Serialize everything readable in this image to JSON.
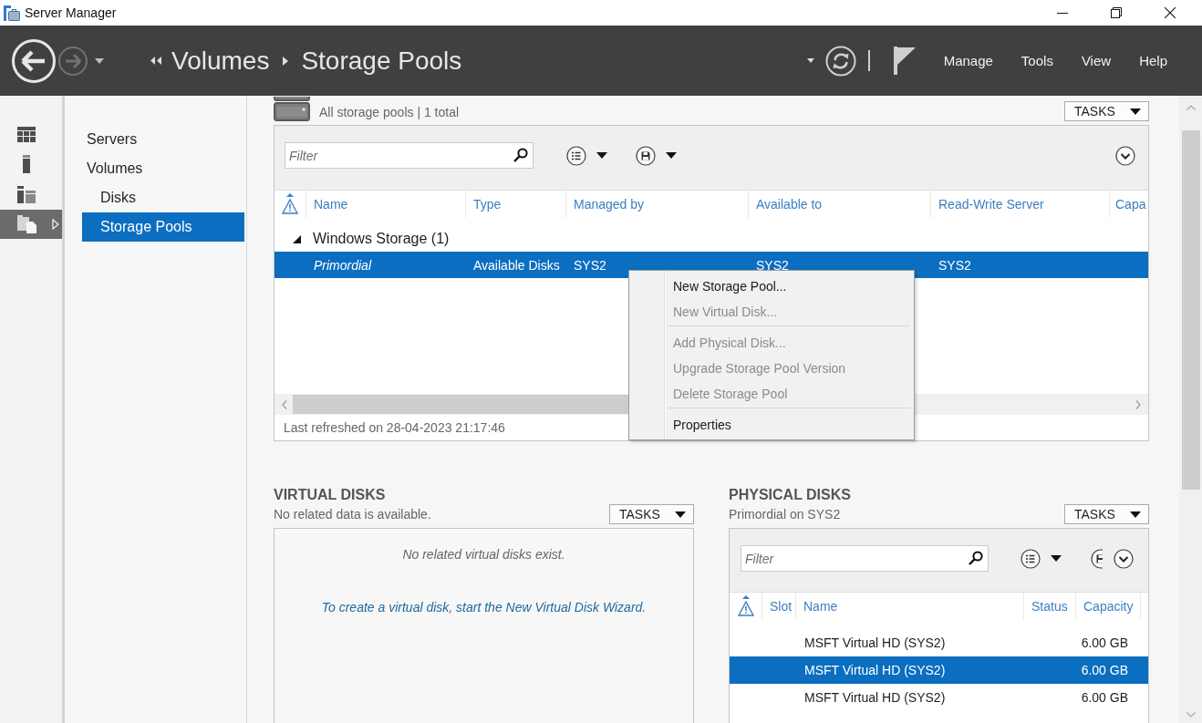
{
  "window": {
    "title": "Server Manager"
  },
  "header": {
    "breadcrumb": [
      "Volumes",
      "Storage Pools"
    ],
    "menu": [
      "Manage",
      "Tools",
      "View",
      "Help"
    ]
  },
  "rail": [
    {
      "selected": false
    },
    {
      "selected": false
    },
    {
      "selected": false
    },
    {
      "selected": true
    }
  ],
  "nav": [
    {
      "label": "Servers",
      "selected": false
    },
    {
      "label": "Volumes",
      "selected": false,
      "children": [
        {
          "label": "Disks",
          "selected": false
        },
        {
          "label": "Storage Pools",
          "selected": true
        }
      ]
    }
  ],
  "storage_pools": {
    "subtitle": "All storage pools | 1 total",
    "tasks": "TASKS",
    "filter": {
      "placeholder": "Filter"
    },
    "columns": [
      "Name",
      "Type",
      "Managed by",
      "Available to",
      "Read-Write Server",
      "Capa"
    ],
    "groups": [
      {
        "label": "Windows Storage (1)",
        "expanded": true,
        "rows": [
          {
            "kind": "primordial",
            "selected": true,
            "cells": [
              "Primordial",
              "Available Disks",
              "SYS2",
              "SYS2",
              "SYS2"
            ]
          }
        ]
      }
    ],
    "status": "Last refreshed on 28-04-2023 21:17:46"
  },
  "context_menu": {
    "sections": [
      {
        "items": [
          {
            "label": "New Storage Pool...",
            "disabled": false
          },
          {
            "label": "New Virtual Disk...",
            "disabled": true
          }
        ]
      },
      {
        "items": [
          {
            "label": "Add Physical Disk...",
            "disabled": true
          },
          {
            "label": "Upgrade Storage Pool Version",
            "disabled": true
          },
          {
            "label": "Delete Storage Pool",
            "disabled": true
          }
        ]
      },
      {
        "items": [
          {
            "label": "Properties",
            "disabled": false
          }
        ]
      }
    ]
  },
  "virtual_disks": {
    "title": "VIRTUAL DISKS",
    "subtitle": "No related data is available.",
    "tasks": "TASKS",
    "message": "No related virtual disks exist.",
    "link": "To create a virtual disk, start the New Virtual Disk Wizard."
  },
  "physical_disks": {
    "title": "PHYSICAL DISKS",
    "subtitle": "Primordial on SYS2",
    "tasks": "TASKS",
    "filter": {
      "placeholder": "Filter"
    },
    "columns": [
      "Slot",
      "Name",
      "Status",
      "Capacity"
    ],
    "rows": [
      {
        "name": "MSFT Virtual HD (SYS2)",
        "capacity": "6.00 GB",
        "selected": false
      },
      {
        "name": "MSFT Virtual HD (SYS2)",
        "capacity": "6.00 GB",
        "selected": true
      },
      {
        "name": "MSFT Virtual HD (SYS2)",
        "capacity": "6.00 GB",
        "selected": false
      }
    ]
  }
}
